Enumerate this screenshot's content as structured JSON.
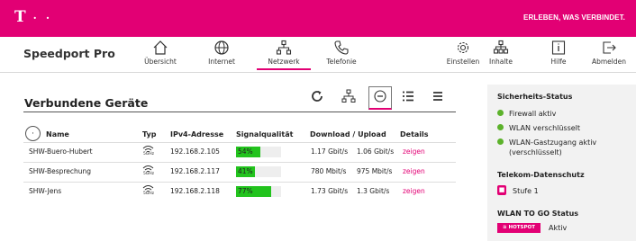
{
  "header": {
    "logo_letter": "T",
    "logo_dots": "· ·",
    "slogan": "ERLEBEN, WAS VERBINDET."
  },
  "nav": {
    "brand": "Speedport Pro",
    "items": [
      {
        "label": "Übersicht",
        "icon": "home-icon"
      },
      {
        "label": "Internet",
        "icon": "globe-icon"
      },
      {
        "label": "Netzwerk",
        "icon": "network-icon",
        "active": true
      },
      {
        "label": "Telefonie",
        "icon": "phone-icon"
      },
      {
        "label": "Einstellen",
        "icon": "gear-icon"
      },
      {
        "label": "Inhalte",
        "icon": "content-icon"
      },
      {
        "label": "Hilfe",
        "icon": "help-icon"
      },
      {
        "label": "Abmelden",
        "icon": "logout-icon"
      }
    ]
  },
  "main": {
    "title": "Verbundene Geräte",
    "toolbar": [
      "refresh-icon",
      "network-view-icon",
      "bubble-view-icon",
      "list-view-icon",
      "compact-list-icon"
    ],
    "columns": {
      "name": "Name",
      "type": "Typ",
      "ip": "IPv4-Adresse",
      "signal": "Signalqualität",
      "speed": "Download / Upload",
      "details": "Details"
    },
    "rows": [
      {
        "name": "SHW-Buero-Hubert",
        "band": "5GHz",
        "ip": "192.168.2.105",
        "signal": "54%",
        "signal_value": 0.54,
        "download": "1.17 Gbit/s",
        "upload": "1.06 Gbit/s",
        "details": "zeigen"
      },
      {
        "name": "SHW-Besprechung",
        "band": "5GHz",
        "ip": "192.168.2.117",
        "signal": "41%",
        "signal_value": 0.41,
        "download": "780 Mbit/s",
        "upload": "975 Mbit/s",
        "details": "zeigen"
      },
      {
        "name": "SHW-Jens",
        "band": "5GHz",
        "ip": "192.168.2.118",
        "signal": "77%",
        "signal_value": 0.77,
        "download": "1.73 Gbit/s",
        "upload": "1.3 Gbit/s",
        "details": "zeigen"
      }
    ]
  },
  "sidebar": {
    "security_title": "Sicherheits-Status",
    "security_items": [
      "Firewall aktiv",
      "WLAN verschlüsselt",
      "WLAN-Gastzugang aktiv (verschlüsselt)"
    ],
    "privacy_title": "Telekom-Datenschutz",
    "privacy_level": "Stufe 1",
    "wlan_togo_title": "WLAN TO GO Status",
    "hotspot_label": "HOTSPOT",
    "wlan_togo_status": "Aktiv"
  },
  "colors": {
    "brand": "#e20074",
    "signal": "#22c31d",
    "status_ok": "#5cb22b"
  }
}
